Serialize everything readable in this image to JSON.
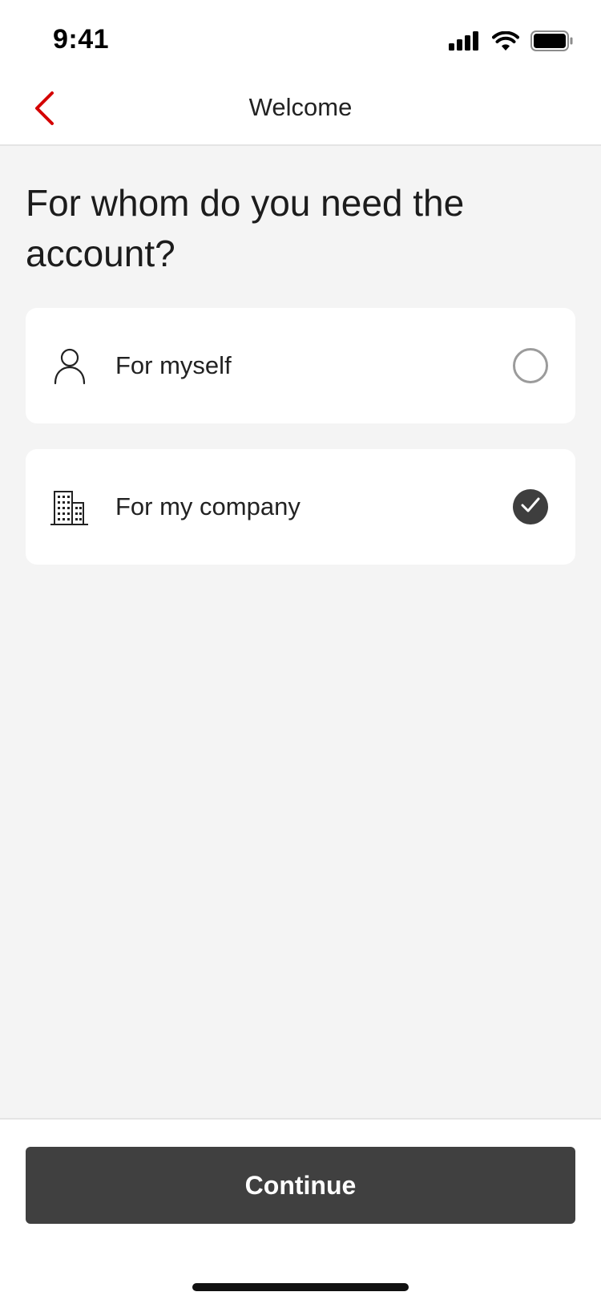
{
  "status_bar": {
    "time": "9:41",
    "icons": [
      "cellular-signal-icon",
      "wifi-icon",
      "battery-icon"
    ]
  },
  "nav": {
    "title": "Welcome",
    "back_icon": "chevron-left-icon"
  },
  "question": "For whom do you need the account?",
  "options": [
    {
      "label": "For myself",
      "icon": "person-icon",
      "selected": false
    },
    {
      "label": "For my company",
      "icon": "building-icon",
      "selected": true
    }
  ],
  "footer": {
    "continue_label": "Continue"
  },
  "colors": {
    "accent": "#d40000",
    "background": "#f4f4f4",
    "card": "#ffffff",
    "button": "#404040",
    "radio_border": "#9b9b9b",
    "radio_checked": "#3e3e3e"
  }
}
